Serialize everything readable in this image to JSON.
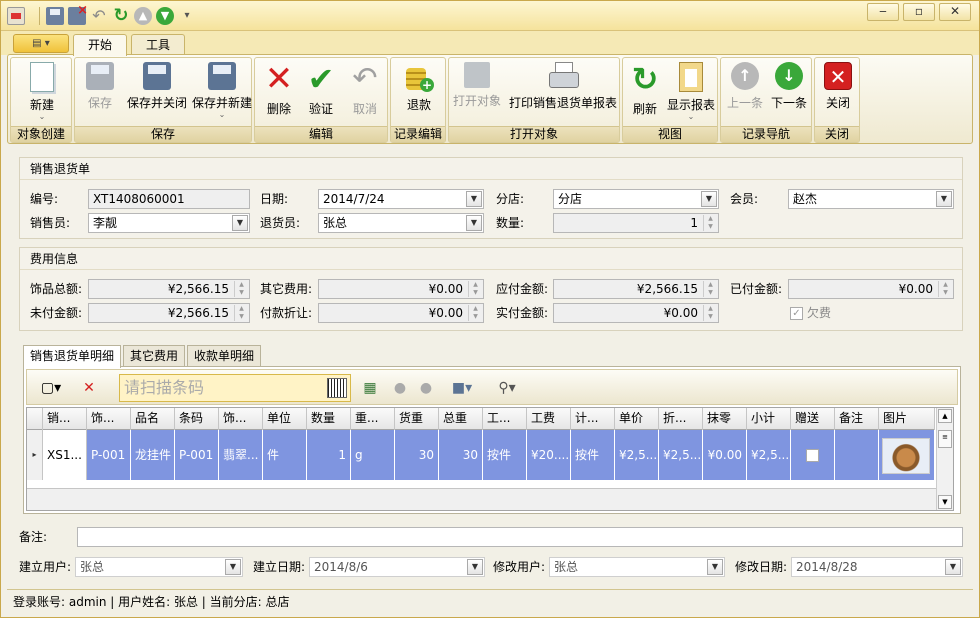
{
  "ribbon_tabs": {
    "app_menu": "",
    "start": "开始",
    "tools": "工具"
  },
  "ribbon": {
    "groups": {
      "create": {
        "label": "对象创建",
        "new": "新建"
      },
      "save": {
        "label": "保存",
        "save": "保存",
        "save_close": "保存并关闭",
        "save_new": "保存并新建"
      },
      "edit": {
        "label": "编辑",
        "delete": "删除",
        "verify": "验证",
        "cancel": "取消"
      },
      "record_edit": {
        "label": "记录编辑",
        "return": "退款"
      },
      "open": {
        "label": "打开对象",
        "open_object": "打开对象",
        "print": "打印销售退货单报表"
      },
      "view": {
        "label": "视图",
        "refresh": "刷新",
        "show_report": "显示报表"
      },
      "nav": {
        "label": "记录导航",
        "prev": "上一条",
        "next": "下一条"
      },
      "close": {
        "label": "关闭",
        "close": "关闭"
      }
    }
  },
  "return_form": {
    "title": "销售退货单",
    "code_label": "编号:",
    "code_value": "XT1408060001",
    "date_label": "日期:",
    "date_value": "2014/7/24",
    "branch_label": "分店:",
    "branch_value": "分店",
    "member_label": "会员:",
    "member_value": "赵杰",
    "salesperson_label": "销售员:",
    "salesperson_value": "李靓",
    "returner_label": "退货员:",
    "returner_value": "张总",
    "qty_label": "数量:",
    "qty_value": "1"
  },
  "fees": {
    "title": "费用信息",
    "jewelry_total_label": "饰品总额:",
    "jewelry_total_value": "¥2,566.15",
    "other_fee_label": "其它费用:",
    "other_fee_value": "¥0.00",
    "payable_label": "应付金额:",
    "payable_value": "¥2,566.15",
    "paid_label": "已付金额:",
    "paid_value": "¥0.00",
    "unpaid_label": "未付金额:",
    "unpaid_value": "¥2,566.15",
    "discount_label": "付款折让:",
    "discount_value": "¥0.00",
    "actual_label": "实付金额:",
    "actual_value": "¥0.00",
    "owe_label": "欠费",
    "owe_checked": true
  },
  "detail_tabs": [
    "销售退货单明细",
    "其它费用",
    "收款单明细"
  ],
  "grid": {
    "scan_placeholder": "请扫描条码",
    "columns": [
      "销...",
      "饰...",
      "品名",
      "条码",
      "饰...",
      "单位",
      "数量",
      "重...",
      "货重",
      "总重",
      "工...",
      "工费",
      "计...",
      "单价",
      "折...",
      "抹零",
      "小计",
      "赠送",
      "备注",
      "图片"
    ],
    "rows": [
      [
        "XS1...",
        "P-001",
        "龙挂件",
        "P-001",
        "翡翠...",
        "件",
        "1",
        "g",
        "30",
        "30",
        "按件",
        "¥20....",
        "按件",
        "¥2,5...",
        "¥2,5...",
        "¥0.00",
        "¥2,5...",
        "",
        "",
        ""
      ]
    ]
  },
  "footer": {
    "note_label": "备注:",
    "note_value": "",
    "creator_label": "建立用户:",
    "creator_value": "张总",
    "created_label": "建立日期:",
    "created_value": "2014/8/6",
    "modifier_label": "修改用户:",
    "modifier_value": "张总",
    "modified_label": "修改日期:",
    "modified_value": "2014/8/28"
  },
  "status": {
    "text": "登录账号: admin  |  用户姓名: 张总  |  当前分店: 总店"
  }
}
